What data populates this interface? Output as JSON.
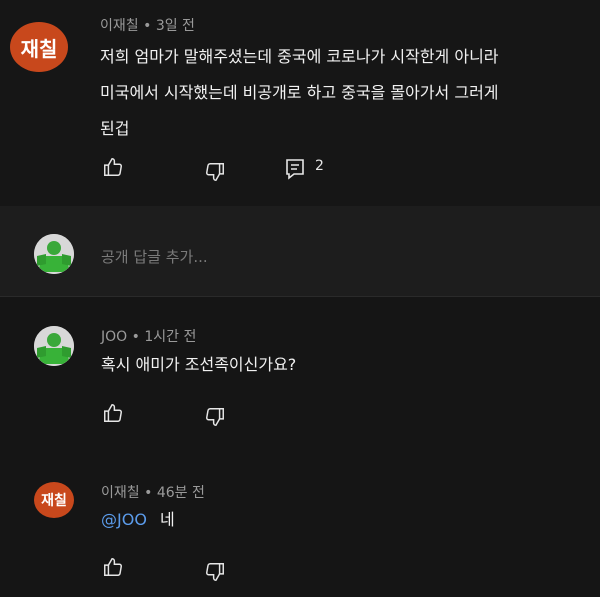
{
  "top_comment": {
    "avatar_text": "재칠",
    "author": "이재칠",
    "separator": "•",
    "time": "3일 전",
    "lines": [
      "저희 엄마가 말해주셨는데  중국에 코로나가 시작한게 아니라",
      "미국에서 시작했는데  비공개로 하고  중국을 몰아가서 그러게",
      "된겁"
    ],
    "reply_count": "2"
  },
  "reply_input": {
    "placeholder": "공개 답글 추가..."
  },
  "replies": [
    {
      "author": "JOO",
      "separator": "•",
      "time": "1시간 전",
      "text": "혹시 애미가 조선족이신가요?"
    },
    {
      "avatar_text": "재칠",
      "author": "이재칠",
      "separator": "•",
      "time": "46분 전",
      "mention": "@JOO",
      "text": "네"
    }
  ],
  "icons": {
    "like": "thumbs-up-icon",
    "dislike": "thumbs-down-icon",
    "reply": "comment-reply-icon"
  },
  "colors": {
    "avatar_bg": "#c8481c",
    "mention": "#5b9bea",
    "background": "#151515"
  }
}
